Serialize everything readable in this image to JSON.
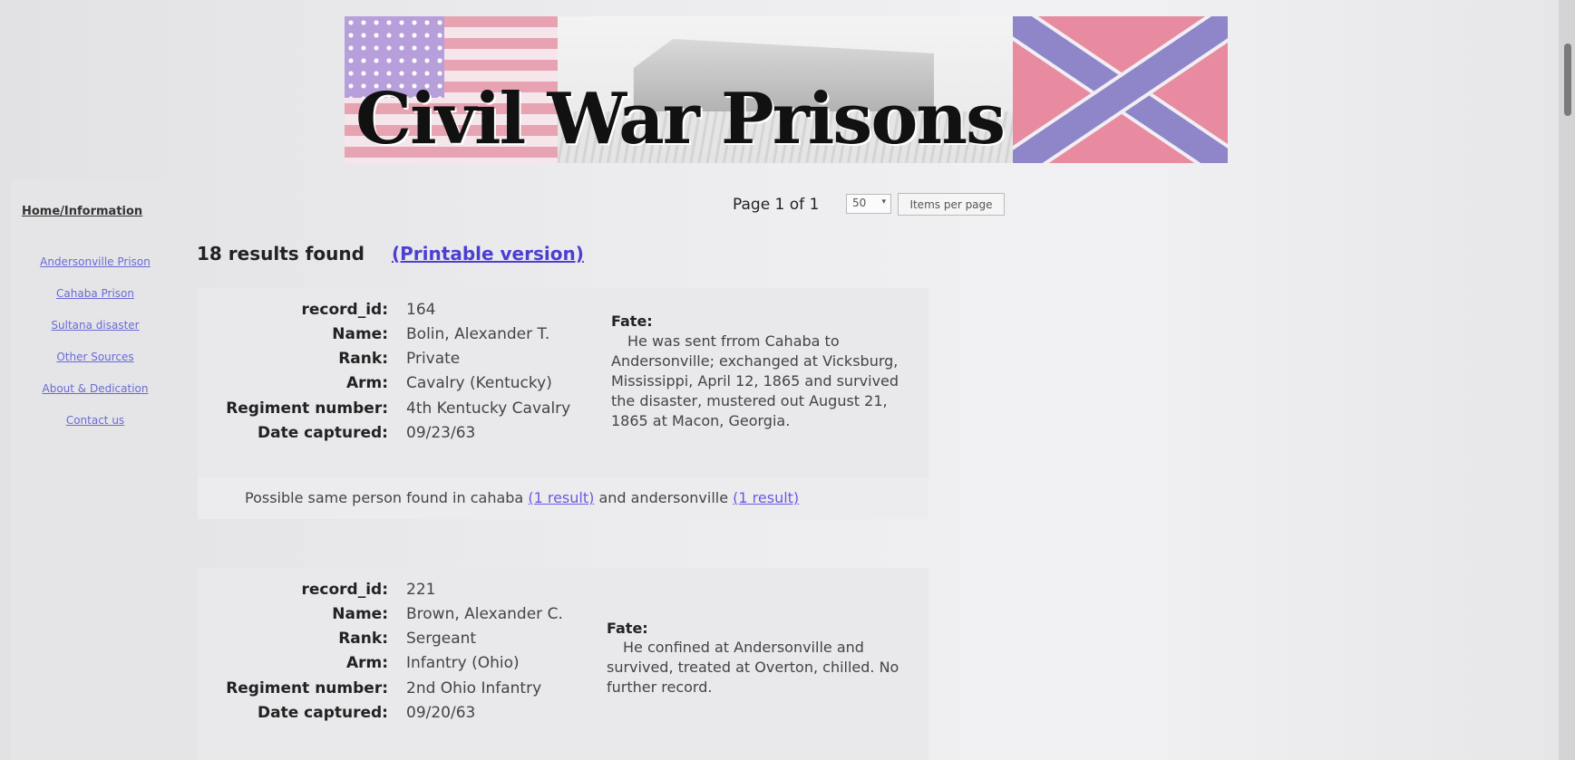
{
  "banner": {
    "title": "Civil War Prisons"
  },
  "sidebar": {
    "home": "Home/Information",
    "links": [
      "Andersonville Prison",
      "Cahaba Prison",
      "Sultana disaster",
      "Other Sources",
      "About & Dedication",
      "Contact us"
    ]
  },
  "pager": {
    "text": "Page 1 of 1",
    "per_page_value": "50",
    "button": "Items per page"
  },
  "results": {
    "count": "18 results found",
    "printable": "(Printable version)"
  },
  "labels": {
    "record_id": "record_id:",
    "name": "Name:",
    "rank": "Rank:",
    "arm": "Arm:",
    "regiment": "Regiment number:",
    "date": "Date captured:",
    "fate": "Fate:"
  },
  "records": [
    {
      "record_id": "164",
      "name": "Bolin, Alexander T.",
      "rank": "Private",
      "arm": "Cavalry (Kentucky)",
      "regiment": "4th Kentucky Cavalry",
      "date": "09/23/63",
      "fate": "He was sent frrom Cahaba to Andersonville; exchanged at Vicksburg, Mississippi, April 12, 1865 and survived the disaster, mustered out August 21, 1865 at Macon, Georgia.",
      "also": {
        "prefix": "Possible same person found in cahaba",
        "link1": "(1 result)",
        "middle": "and andersonville",
        "link2": "(1 result)"
      }
    },
    {
      "record_id": "221",
      "name": "Brown, Alexander C.",
      "rank": "Sergeant",
      "arm": "Infantry (Ohio)",
      "regiment": "2nd Ohio Infantry",
      "date": "09/20/63",
      "fate": "He confined at Andersonville and survived, treated at Overton, chilled. No further record."
    }
  ]
}
